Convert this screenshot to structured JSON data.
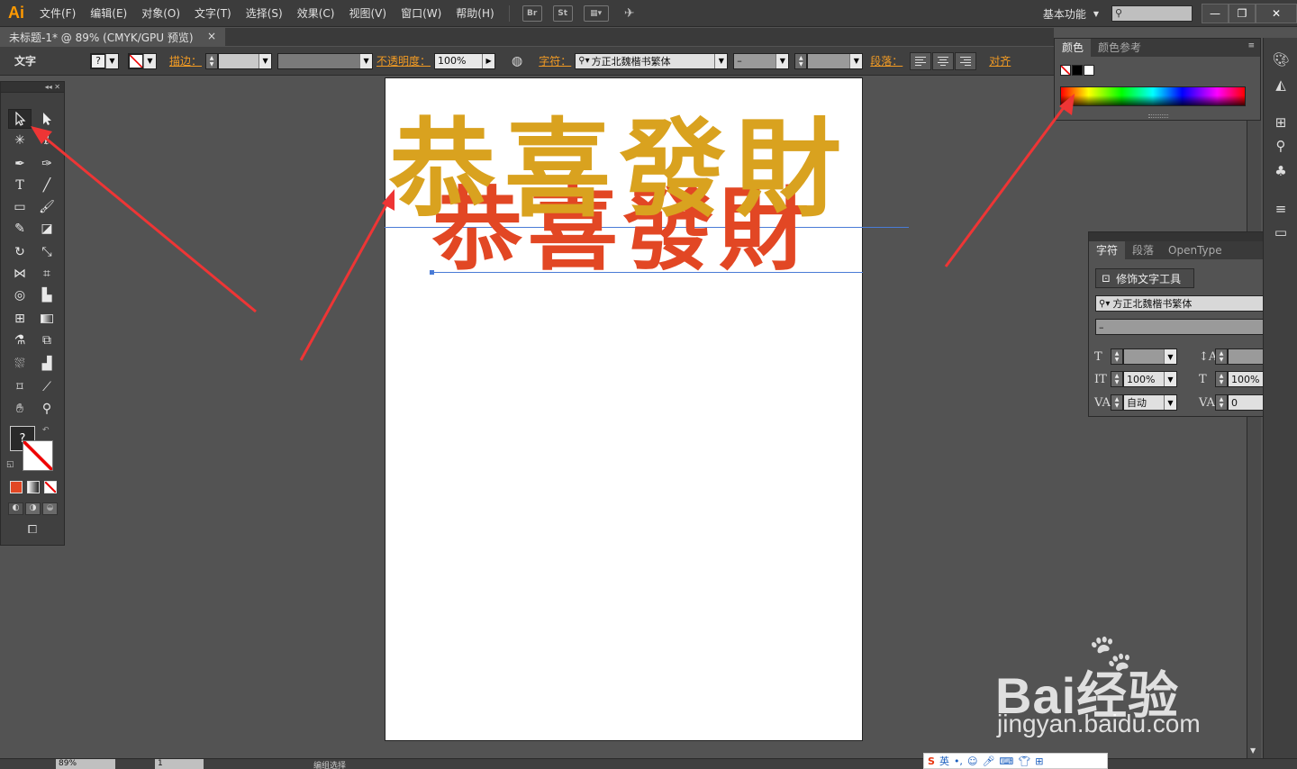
{
  "app": {
    "logo": "Ai",
    "menus": [
      "文件(F)",
      "编辑(E)",
      "对象(O)",
      "文字(T)",
      "选择(S)",
      "效果(C)",
      "视图(V)",
      "窗口(W)",
      "帮助(H)"
    ],
    "bridge_label": "Br",
    "stock_label": "St",
    "workspace_label": "基本功能",
    "window_buttons": [
      "—",
      "❐",
      "✕"
    ]
  },
  "document": {
    "tab_title": "未标题-1* @ 89% (CMYK/GPU 预览)",
    "tab_close": "×"
  },
  "control_bar": {
    "mode_label": "文字",
    "stroke_label": "描边：",
    "opacity_label": "不透明度：",
    "opacity_value": "100%",
    "character_label": "字符：",
    "font_family": "方正北魏楷书繁体",
    "font_style": "–",
    "paragraph_label": "段落：",
    "align_label": "对齐"
  },
  "toolbox": {
    "unknown_fill": "?"
  },
  "artwork": {
    "gold_text": "恭喜發財",
    "red_text": "恭喜發財",
    "gold_color": "#d9a21f",
    "red_color": "#e24724"
  },
  "color_panel": {
    "tabs": [
      "颜色",
      "颜色参考"
    ],
    "menu_icon": "≡"
  },
  "character_panel": {
    "tabs": [
      "字符",
      "段落",
      "OpenType"
    ],
    "touch_tool_label": "修饰文字工具",
    "font_family": "方正北魏楷书繁体",
    "font_style": "–",
    "vertical_scale": "100%",
    "horizontal_scale": "100%",
    "kerning": "自动",
    "tracking": "0"
  },
  "status_bar": {
    "zoom": "89%",
    "page": "1",
    "selection_label": "编组选择"
  },
  "ime": {
    "language": "英"
  },
  "watermark": {
    "brand": "Bai经验",
    "url": "jingyan.baidu.com"
  }
}
